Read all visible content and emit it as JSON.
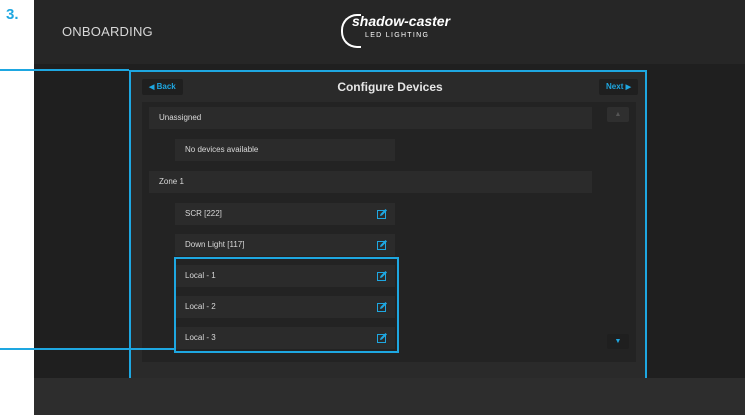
{
  "step_number": "3.",
  "header": {
    "title": "ONBOARDING",
    "logo_main": "shadow-caster",
    "logo_sub": "LED LIGHTING"
  },
  "panel": {
    "title": "Configure Devices",
    "back_label": "Back",
    "next_label": "Next",
    "back_icon": "◀",
    "next_icon": "▶",
    "scroll_up_icon": "▲",
    "scroll_down_icon": "▼"
  },
  "groups": [
    {
      "label": "Unassigned",
      "devices": [
        {
          "label": "No devices available",
          "editable": false
        }
      ]
    },
    {
      "label": "Zone 1",
      "devices": [
        {
          "label": "SCR [222]",
          "editable": true
        },
        {
          "label": "Down Light [117]",
          "editable": true
        },
        {
          "label": "Local - 1",
          "editable": true
        },
        {
          "label": "Local - 2",
          "editable": true
        },
        {
          "label": "Local - 3",
          "editable": true
        }
      ]
    }
  ],
  "colors": {
    "accent": "#1ea7e1",
    "background": "#1f1f1f",
    "row": "#2b2b2b"
  }
}
